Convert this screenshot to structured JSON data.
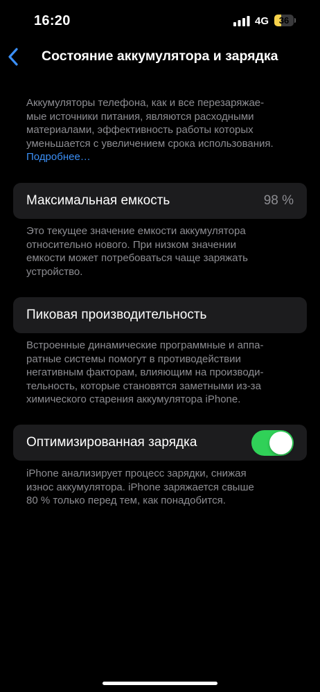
{
  "status_bar": {
    "time": "16:20",
    "network": "4G",
    "battery_percent": "36",
    "battery_level": 0.36,
    "battery_color": "#f7d24b"
  },
  "nav": {
    "back_icon": "chevron-left-icon",
    "title": "Состояние аккумулятора и зарядка"
  },
  "intro": {
    "lines": [
      "Аккумуляторы телефона, как и все перезаряжае-",
      "мые источники питания, являются расходными",
      "материалами, эффективность работы которых",
      "уменьшается с увеличением срока использования."
    ],
    "more_link": "Подробнее…"
  },
  "max_capacity": {
    "label": "Максимальная емкость",
    "value": "98 %",
    "footer_lines": [
      "Это текущее значение емкости аккумулятора",
      "относительно нового. При низком значении",
      "емкости может потребоваться чаще заряжать",
      "устройство."
    ]
  },
  "peak_performance": {
    "label": "Пиковая производительность",
    "footer_lines": [
      "Встроенные динамические программные и аппа-",
      "ратные системы помогут в противодействии",
      "негативным факторам, влияющим на производи-",
      "тельность, которые становятся заметными из-за",
      "химического старения аккумулятора iPhone."
    ]
  },
  "optimized_charging": {
    "label": "Оптимизированная зарядка",
    "enabled": true,
    "toggle_color": "#30d158",
    "footer_lines": [
      "iPhone анализирует процесс зарядки, снижая",
      "износ аккумулятора. iPhone заряжается свыше",
      "80 % только перед тем, как понадобится."
    ]
  },
  "colors": {
    "background": "#000000",
    "cell_background": "#1c1c1e",
    "secondary_text": "#8d8d92",
    "link": "#3b8ff6",
    "accent": "#3b8ff6"
  }
}
